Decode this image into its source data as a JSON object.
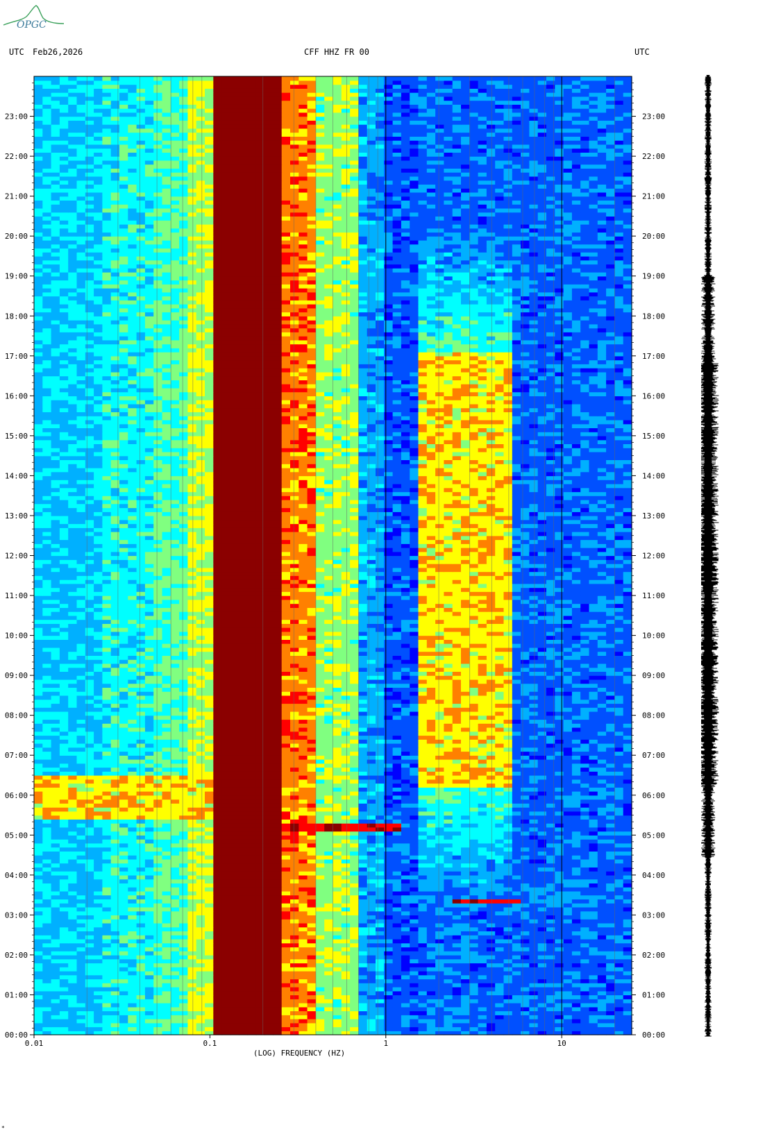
{
  "logo": {
    "text": "OPGC",
    "color": "#2e8b57"
  },
  "header": {
    "left_tz": "UTC",
    "date": "Feb26,2026",
    "station": "CFF HHZ FR 00",
    "right_tz": "UTC"
  },
  "footer_mark": "*",
  "chart_data": {
    "type": "heatmap",
    "title": "CFF HHZ FR 00",
    "xlabel": "(LOG) FREQUENCY (HZ)",
    "ylabel": "",
    "x_scale": "log",
    "xlim": [
      0.01,
      25
    ],
    "x_ticks": [
      {
        "value": 0.01,
        "label": "0.01"
      },
      {
        "value": 0.1,
        "label": "0.1"
      },
      {
        "value": 1,
        "label": "1"
      },
      {
        "value": 10,
        "label": "10"
      }
    ],
    "y_ticks": [
      "00:00",
      "01:00",
      "02:00",
      "03:00",
      "04:00",
      "05:00",
      "06:00",
      "07:00",
      "08:00",
      "09:00",
      "10:00",
      "11:00",
      "12:00",
      "13:00",
      "14:00",
      "15:00",
      "16:00",
      "17:00",
      "18:00",
      "19:00",
      "20:00",
      "21:00",
      "22:00",
      "23:00"
    ],
    "ylim_hours": [
      0,
      24
    ],
    "colormap": [
      "#00008b",
      "#0000ff",
      "#0050ff",
      "#00b0ff",
      "#00ffff",
      "#80ff80",
      "#ffff00",
      "#ff8000",
      "#ff0000",
      "#8b0000"
    ],
    "features": [
      {
        "name": "microseism band",
        "freq_range": [
          0.1,
          0.25
        ],
        "level": "saturated"
      },
      {
        "name": "daytime anthropogenic noise",
        "freq_range": [
          1.5,
          5
        ],
        "time_range": [
          6.2,
          17
        ],
        "level": "high"
      },
      {
        "name": "event",
        "freq_range": [
          0.25,
          1.2
        ],
        "time": 5.15,
        "level": "high"
      },
      {
        "name": "event",
        "freq_range": [
          2.5,
          6
        ],
        "time": 3.3,
        "level": "high"
      },
      {
        "name": "low-frequency event",
        "freq_range": [
          0.01,
          0.1
        ],
        "time_range": [
          5.4,
          6.4
        ],
        "level": "high"
      }
    ]
  }
}
